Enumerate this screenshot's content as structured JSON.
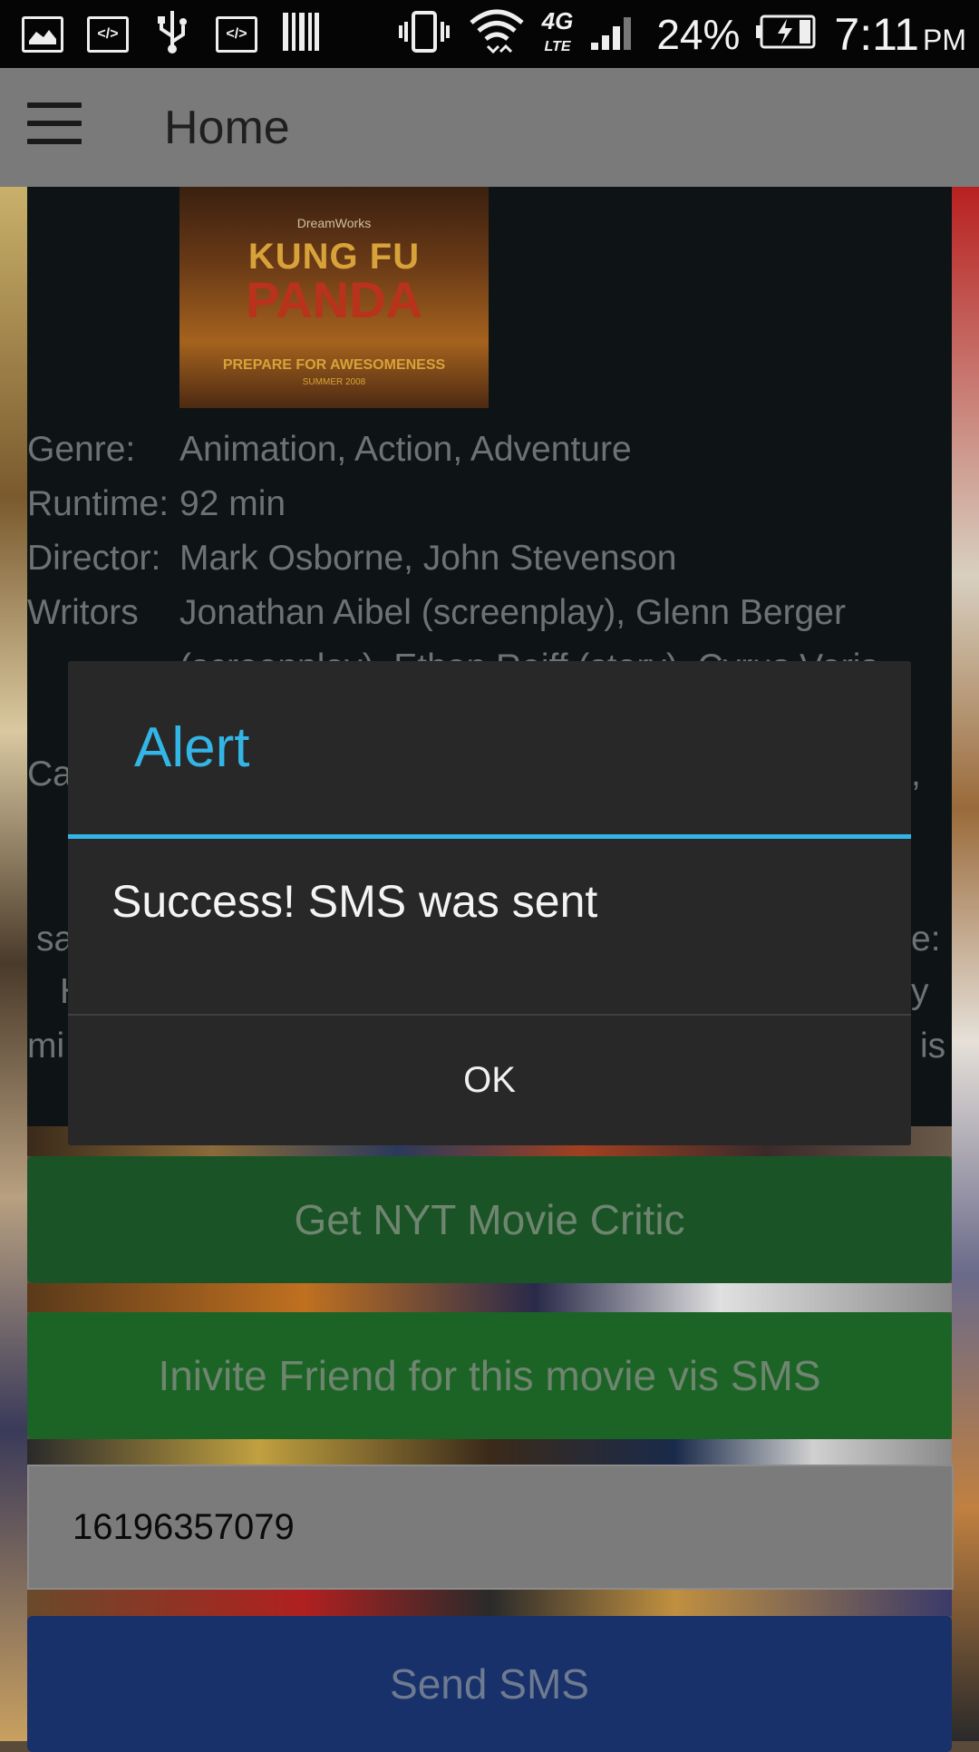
{
  "status_bar": {
    "battery_percent": "24%",
    "time": "7:11",
    "am_pm": "PM",
    "network": "4G LTE",
    "icons": [
      "image-icon",
      "code-icon",
      "usb-icon",
      "code-icon",
      "barcode-icon",
      "vibrate-icon",
      "wifi-icon",
      "lte-icon",
      "signal-icon",
      "battery-charging-icon"
    ]
  },
  "app_bar": {
    "title": "Home",
    "menu_icon": "hamburger-menu-icon"
  },
  "movie": {
    "poster": {
      "studio": "DreamWorks",
      "title_line1": "KUNG FU",
      "title_line2": "PANDA",
      "tagline": "PREPARE FOR AWESOMENESS",
      "release": "SUMMER 2008"
    },
    "details": [
      {
        "label": "Genre:",
        "value": "Animation, Action, Adventure"
      },
      {
        "label": "Runtime:",
        "value": "92 min"
      },
      {
        "label": "Director:",
        "value": "Mark Osborne, John Stevenson"
      },
      {
        "label": "Writors",
        "value": "Jonathan Aibel (screenplay), Glenn Berger"
      }
    ],
    "partial_text": {
      "writers_cont": "(screenplay), Ethan Reiff (story), Cyrus Voris",
      "cast_label": "Ca",
      "right_comma": ",",
      "left_sa": "sa",
      "right_e": "e:",
      "left_h": "H",
      "right_y": "y",
      "left_mi": "mi",
      "right_is": "is"
    }
  },
  "buttons": {
    "critic": "Get NYT Movie Critic",
    "invite": "Inivite Friend for this movie vis SMS",
    "send": "Send SMS"
  },
  "phone_input": {
    "value": "16196357079"
  },
  "dialog": {
    "title": "Alert",
    "message": "Success! SMS was sent",
    "ok": "OK"
  },
  "colors": {
    "accent": "#33b5e5",
    "dialog_bg": "#282828",
    "green_button": "#1b6426",
    "blue_button": "#18316a"
  }
}
